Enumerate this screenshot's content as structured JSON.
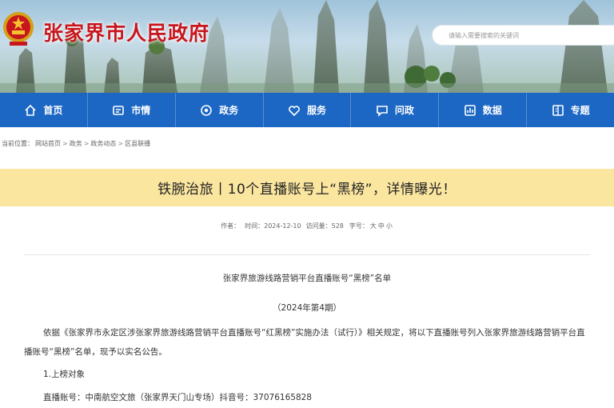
{
  "header": {
    "site_title": "张家界市人民政府",
    "search_placeholder": "请输入需要搜索的关键词"
  },
  "nav": {
    "items": [
      {
        "label": "首页",
        "icon": "home-icon"
      },
      {
        "label": "市情",
        "icon": "city-info-icon"
      },
      {
        "label": "政务",
        "icon": "gov-affairs-icon"
      },
      {
        "label": "服务",
        "icon": "service-icon"
      },
      {
        "label": "问政",
        "icon": "consult-icon"
      },
      {
        "label": "数据",
        "icon": "data-icon"
      },
      {
        "label": "专题",
        "icon": "topic-icon"
      }
    ]
  },
  "breadcrumb": {
    "prefix": "当前位置：",
    "items": [
      "网站首页",
      "政务",
      "政务动态",
      "区县联播"
    ],
    "separator": ">"
  },
  "article": {
    "title": "铁腕治旅丨10个直播账号上“黑榜”，详情曝光！",
    "meta": {
      "author": "作者：",
      "time": "时间：2024-12-10",
      "visits": "访问量：528",
      "font_label": "字号：",
      "font_sizes": [
        "大",
        "中",
        "小"
      ]
    },
    "doc_title": "张家界旅游线路营销平台直播账号“黑榜”名单",
    "doc_issue": "（2024年第4期）",
    "paragraph": "依据《张家界市永定区涉张家界旅游线路营销平台直播账号“红黑榜”实施办法（试行）》相关规定，将以下直播账号列入张家界旅游线路营销平台直播账号“黑榜”名单，现予以实名公告。",
    "section_heading": "1.上榜对象",
    "account_line": "直播账号：中南航空文旅（张家界天门山专场）抖音号：37076165828"
  },
  "colors": {
    "brand_red": "#c8161d",
    "nav_blue": "#1c67c4",
    "title_band": "#fbe6a0"
  }
}
